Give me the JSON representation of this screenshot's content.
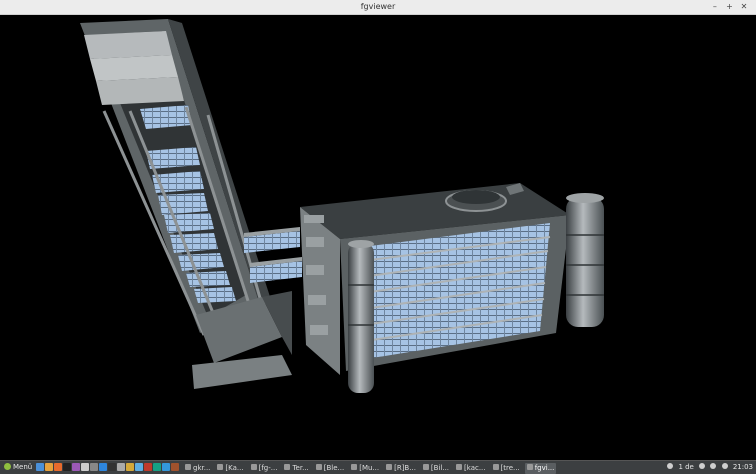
{
  "window": {
    "title": "fgviewer",
    "controls": {
      "minimize": "–",
      "maximize": "+",
      "close": "✕"
    }
  },
  "scene": {
    "description_icon": "3d-building-model",
    "background": "#000000",
    "glass_color": "#a9c6e6",
    "concrete_color": "#7f8587"
  },
  "taskbar": {
    "menu_label": "Menü",
    "launchers": [
      {
        "name": "show-desktop-icon",
        "color": "#4a90d9"
      },
      {
        "name": "files-icon",
        "color": "#e6a13c"
      },
      {
        "name": "firefox-icon",
        "color": "#e86a2c"
      },
      {
        "name": "terminal-icon",
        "color": "#222222"
      },
      {
        "name": "image-icon",
        "color": "#9b59b6"
      },
      {
        "name": "editor-icon",
        "color": "#cccccc"
      },
      {
        "name": "settings-icon",
        "color": "#888888"
      },
      {
        "name": "browser-icon",
        "color": "#2e86de"
      },
      {
        "name": "shell-icon",
        "color": "#333333"
      },
      {
        "name": "calculator-icon",
        "color": "#aaaaaa"
      },
      {
        "name": "folder-icon",
        "color": "#d4a838"
      },
      {
        "name": "image-viewer-icon",
        "color": "#5dade2"
      },
      {
        "name": "app-icon",
        "color": "#c0392b"
      },
      {
        "name": "network-icon",
        "color": "#16a085"
      },
      {
        "name": "globe-icon",
        "color": "#3498db"
      },
      {
        "name": "archive-icon",
        "color": "#a0522d"
      }
    ],
    "tasks": [
      {
        "label": "gkr...",
        "active": false
      },
      {
        "label": "[Ka...",
        "active": false
      },
      {
        "label": "[fg-...",
        "active": false
      },
      {
        "label": "Ter...",
        "active": false
      },
      {
        "label": "[Ble...",
        "active": false
      },
      {
        "label": "[Mu...",
        "active": false
      },
      {
        "label": "[R]B...",
        "active": false
      },
      {
        "label": "[Bil...",
        "active": false
      },
      {
        "label": "[kac...",
        "active": false
      },
      {
        "label": "[tre...",
        "active": false
      },
      {
        "label": "fgvi...",
        "active": true
      }
    ],
    "tray": {
      "workspace": "1 de",
      "clock": "21:03"
    }
  }
}
